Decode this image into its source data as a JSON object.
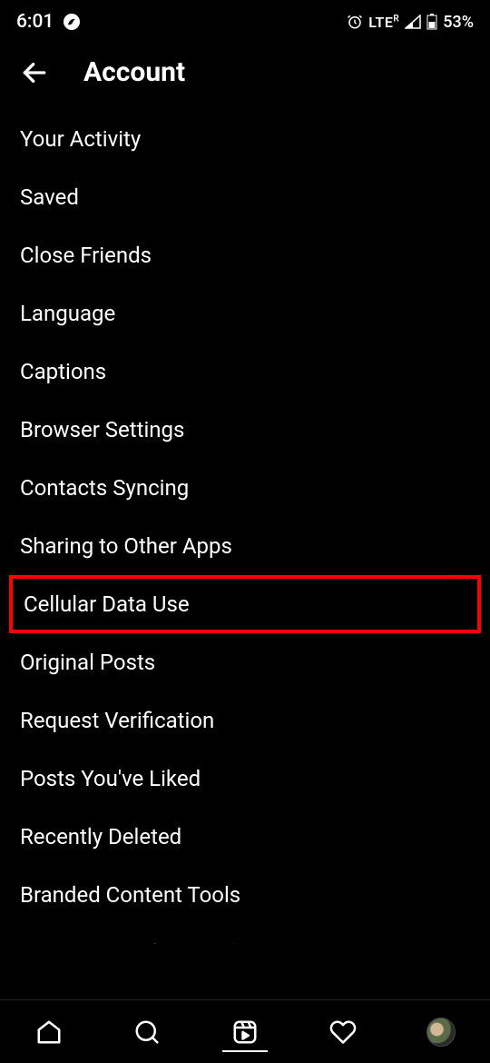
{
  "statusBar": {
    "time": "6:01",
    "network": "LTE",
    "networkSub": "R",
    "battery": "53%"
  },
  "appBar": {
    "title": "Account"
  },
  "menuItems": [
    {
      "label": "Your Activity",
      "highlighted": false
    },
    {
      "label": "Saved",
      "highlighted": false
    },
    {
      "label": "Close Friends",
      "highlighted": false
    },
    {
      "label": "Language",
      "highlighted": false
    },
    {
      "label": "Captions",
      "highlighted": false
    },
    {
      "label": "Browser Settings",
      "highlighted": false
    },
    {
      "label": "Contacts Syncing",
      "highlighted": false
    },
    {
      "label": "Sharing to Other Apps",
      "highlighted": false
    },
    {
      "label": "Cellular Data Use",
      "highlighted": true
    },
    {
      "label": "Original Posts",
      "highlighted": false
    },
    {
      "label": "Request Verification",
      "highlighted": false
    },
    {
      "label": "Posts You've Liked",
      "highlighted": false
    },
    {
      "label": "Recently Deleted",
      "highlighted": false
    },
    {
      "label": "Branded Content Tools",
      "highlighted": false
    }
  ],
  "partialItem": {
    "label": "Switch to Professional Account"
  }
}
